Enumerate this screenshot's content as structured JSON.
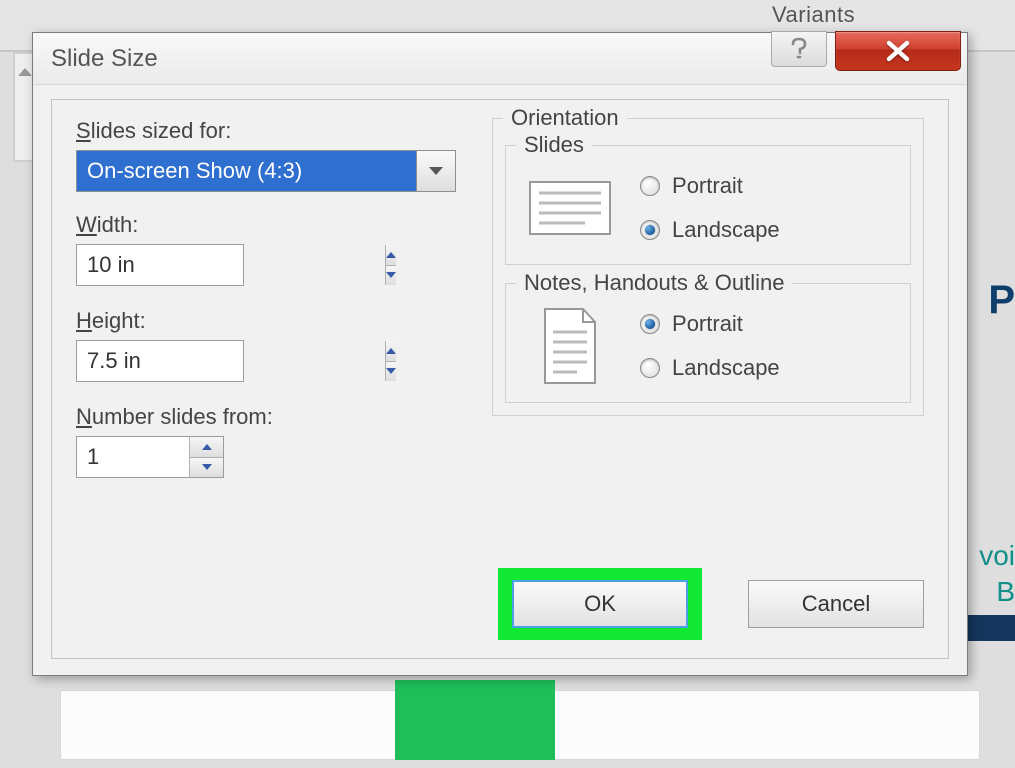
{
  "background": {
    "ribbon_label": "Variants",
    "text1": "P",
    "text2": "voi",
    "text3": "B"
  },
  "dialog": {
    "title": "Slide Size",
    "slidesSizedFor": {
      "label_pre": "S",
      "label_post": "lides sized for:",
      "value": "On-screen Show (4:3)"
    },
    "width": {
      "label_pre": "W",
      "label_post": "idth:",
      "value": "10 in"
    },
    "height": {
      "label_pre": "H",
      "label_post": "eight:",
      "value": "7.5 in"
    },
    "numberFrom": {
      "label_pre": "N",
      "label_post": "umber slides from:",
      "value": "1"
    },
    "orientation": {
      "legend": "Orientation",
      "slides": {
        "legend": "Slides",
        "portrait_pre": "P",
        "portrait_post": "ortrait",
        "landscape_pre": "L",
        "landscape_post": "andscape",
        "selected": "landscape"
      },
      "notes": {
        "legend": "Notes, Handouts & Outline",
        "portrait_pre": "P",
        "portrait_post": "ortrait",
        "landscape_pre": "L",
        "landscape_post": "andscape",
        "selected": "portrait"
      }
    },
    "buttons": {
      "ok": "OK",
      "cancel": "Cancel"
    }
  }
}
